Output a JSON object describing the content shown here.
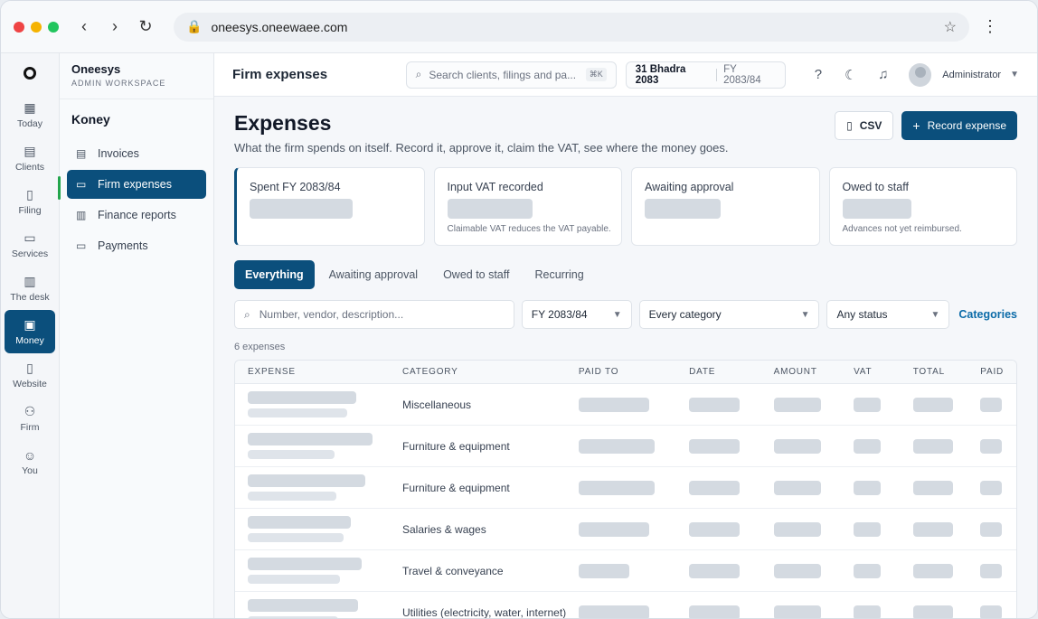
{
  "browser": {
    "url": "oneesys.oneewaee.com"
  },
  "colors": {
    "primary": "#0b4f7c",
    "link": "#0b6ba8",
    "skeleton": "#d4dae1"
  },
  "rail": {
    "items": [
      {
        "label": "Today",
        "icon": "grid-icon"
      },
      {
        "label": "Clients",
        "icon": "building-icon"
      },
      {
        "label": "Filing",
        "icon": "document-icon"
      },
      {
        "label": "Services",
        "icon": "briefcase-icon"
      },
      {
        "label": "The desk",
        "icon": "calendar-icon"
      },
      {
        "label": "Money",
        "icon": "wallet-icon",
        "active": true
      },
      {
        "label": "Website",
        "icon": "page-icon"
      },
      {
        "label": "Firm",
        "icon": "people-icon"
      },
      {
        "label": "You",
        "icon": "user-icon"
      }
    ]
  },
  "brand": {
    "name": "Oneesys",
    "subtitle": "ADMIN WORKSPACE"
  },
  "subnav": {
    "title": "Koney",
    "items": [
      {
        "label": "Invoices",
        "icon": "invoice-icon"
      },
      {
        "label": "Firm expenses",
        "icon": "card-icon",
        "active": true
      },
      {
        "label": "Finance reports",
        "icon": "report-icon"
      },
      {
        "label": "Payments",
        "icon": "payment-icon"
      }
    ]
  },
  "appbar": {
    "title": "Firm expenses",
    "search_placeholder": "Search clients, filings and pa...",
    "search_shortcut": "⌘K",
    "date": "31 Bhadra 2083",
    "fiscal_year": "FY 2083/84",
    "user": "Administrator"
  },
  "page": {
    "title": "Expenses",
    "subtitle": "What the firm spends on itself. Record it, approve it, claim the VAT, see where the money goes.",
    "csv_label": "CSV",
    "record_label": "Record expense"
  },
  "stats": [
    {
      "label": "Spent FY 2083/84",
      "note": ""
    },
    {
      "label": "Input VAT recorded",
      "note": "Claimable VAT reduces the VAT payable."
    },
    {
      "label": "Awaiting approval",
      "note": ""
    },
    {
      "label": "Owed to staff",
      "note": "Advances not yet reimbursed."
    }
  ],
  "tabs": [
    {
      "label": "Everything",
      "active": true
    },
    {
      "label": "Awaiting approval"
    },
    {
      "label": "Owed to staff"
    },
    {
      "label": "Recurring"
    }
  ],
  "filters": {
    "search_placeholder": "Number, vendor, description...",
    "fy": "FY 2083/84",
    "category": "Every category",
    "status": "Any status",
    "categories_link": "Categories"
  },
  "count_label": "6 expenses",
  "table": {
    "columns": [
      "EXPENSE",
      "CATEGORY",
      "PAID TO",
      "DATE",
      "AMOUNT",
      "VAT",
      "TOTAL",
      "PAID"
    ],
    "rows": [
      {
        "category": "Miscellaneous"
      },
      {
        "category": "Furniture & equipment"
      },
      {
        "category": "Furniture & equipment"
      },
      {
        "category": "Salaries & wages"
      },
      {
        "category": "Travel & conveyance"
      },
      {
        "category": "Utilities (electricity, water, internet)"
      }
    ]
  }
}
